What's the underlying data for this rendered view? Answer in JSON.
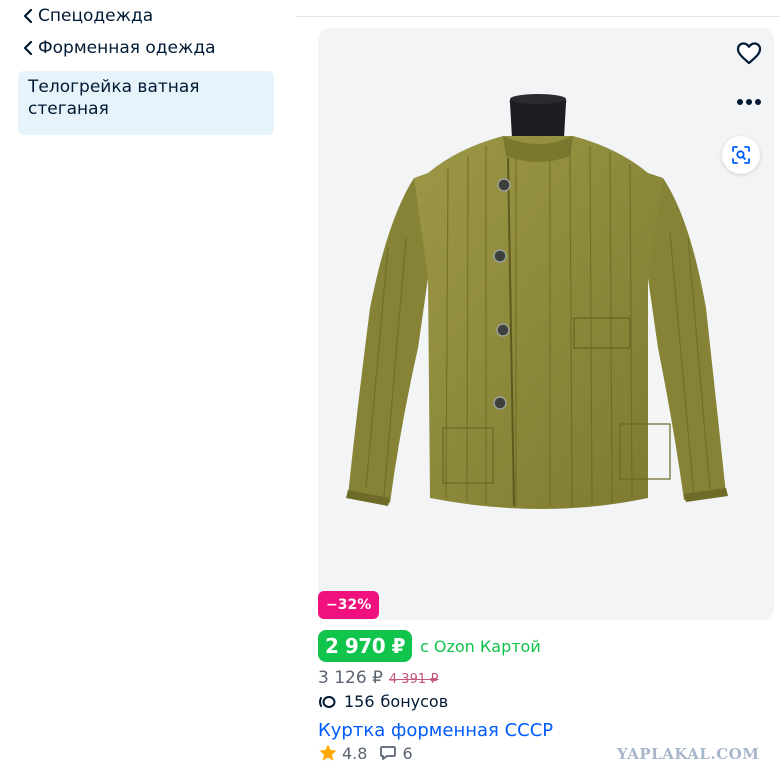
{
  "sidebar": {
    "crumbs": [
      {
        "label": "Спецодежда"
      },
      {
        "label": "Форменная одежда"
      }
    ],
    "active": {
      "line1": "Телогрейка ватная",
      "line2": "стеганая"
    }
  },
  "product": {
    "icons": {
      "favorite": "heart-icon",
      "more": "more-dots-icon",
      "scan": "image-search-icon"
    },
    "discount_badge": "−32%",
    "ozon_price": "2 970 ₽",
    "ozon_card_label": "с Ozon Картой",
    "price": "3 126 ₽",
    "old_price": "4 391 ₽",
    "bonus_count": "156",
    "bonus_label": "бонусов",
    "title": "Куртка форменная СССР",
    "rating": "4.8",
    "reviews": "6"
  },
  "watermark": "YAPLAKAL.COM",
  "colors": {
    "accent_blue": "#005bff",
    "discount_pink": "#f1117e",
    "ozon_green": "#10c44c",
    "star": "#ffa800",
    "jacket": "#8e8a3c"
  }
}
